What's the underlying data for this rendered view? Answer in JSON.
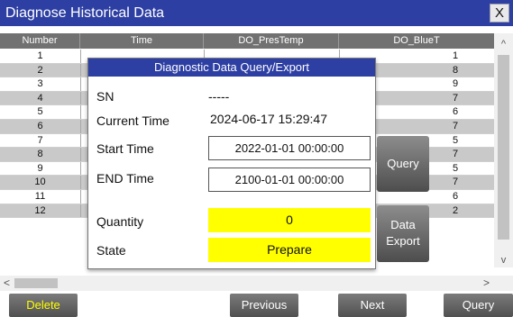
{
  "window": {
    "title": "Diagnose Historical Data",
    "close_label": "X"
  },
  "table": {
    "columns": [
      "Number",
      "Time",
      "DO_PresTemp",
      "DO_BlueT"
    ],
    "rows": [
      {
        "number": "1",
        "blue": "1"
      },
      {
        "number": "2",
        "blue": "8"
      },
      {
        "number": "3",
        "blue": "9"
      },
      {
        "number": "4",
        "blue": "7"
      },
      {
        "number": "5",
        "blue": "6"
      },
      {
        "number": "6",
        "blue": "7"
      },
      {
        "number": "7",
        "blue": "5"
      },
      {
        "number": "8",
        "blue": "7"
      },
      {
        "number": "9",
        "blue": "5"
      },
      {
        "number": "10",
        "blue": "7"
      },
      {
        "number": "11",
        "blue": "6"
      },
      {
        "number": "12",
        "blue": "2"
      }
    ]
  },
  "scroll": {
    "up": "^",
    "down": "v",
    "left": "<",
    "right": ">"
  },
  "buttons": {
    "delete": "Delete",
    "previous": "Previous",
    "next": "Next",
    "query": "Query"
  },
  "dialog": {
    "title": "Diagnostic Data Query/Export",
    "sn_label": "SN",
    "sn_value": "-----",
    "current_time_label": "Current Time",
    "current_time_value": "2024-06-17 15:29:47",
    "start_time_label": "Start Time",
    "start_time_value": "2022-01-01 00:00:00",
    "end_time_label": "END Time",
    "end_time_value": "2100-01-01 00:00:00",
    "quantity_label": "Quantity",
    "quantity_value": "0",
    "state_label": "State",
    "state_value": "Prepare",
    "query_button": "Query",
    "export_button_line1": "Data",
    "export_button_line2": "Export"
  },
  "colors": {
    "titlebar": "#2e3fa3",
    "highlight": "#ffff00",
    "delete_text": "#ffff00"
  }
}
